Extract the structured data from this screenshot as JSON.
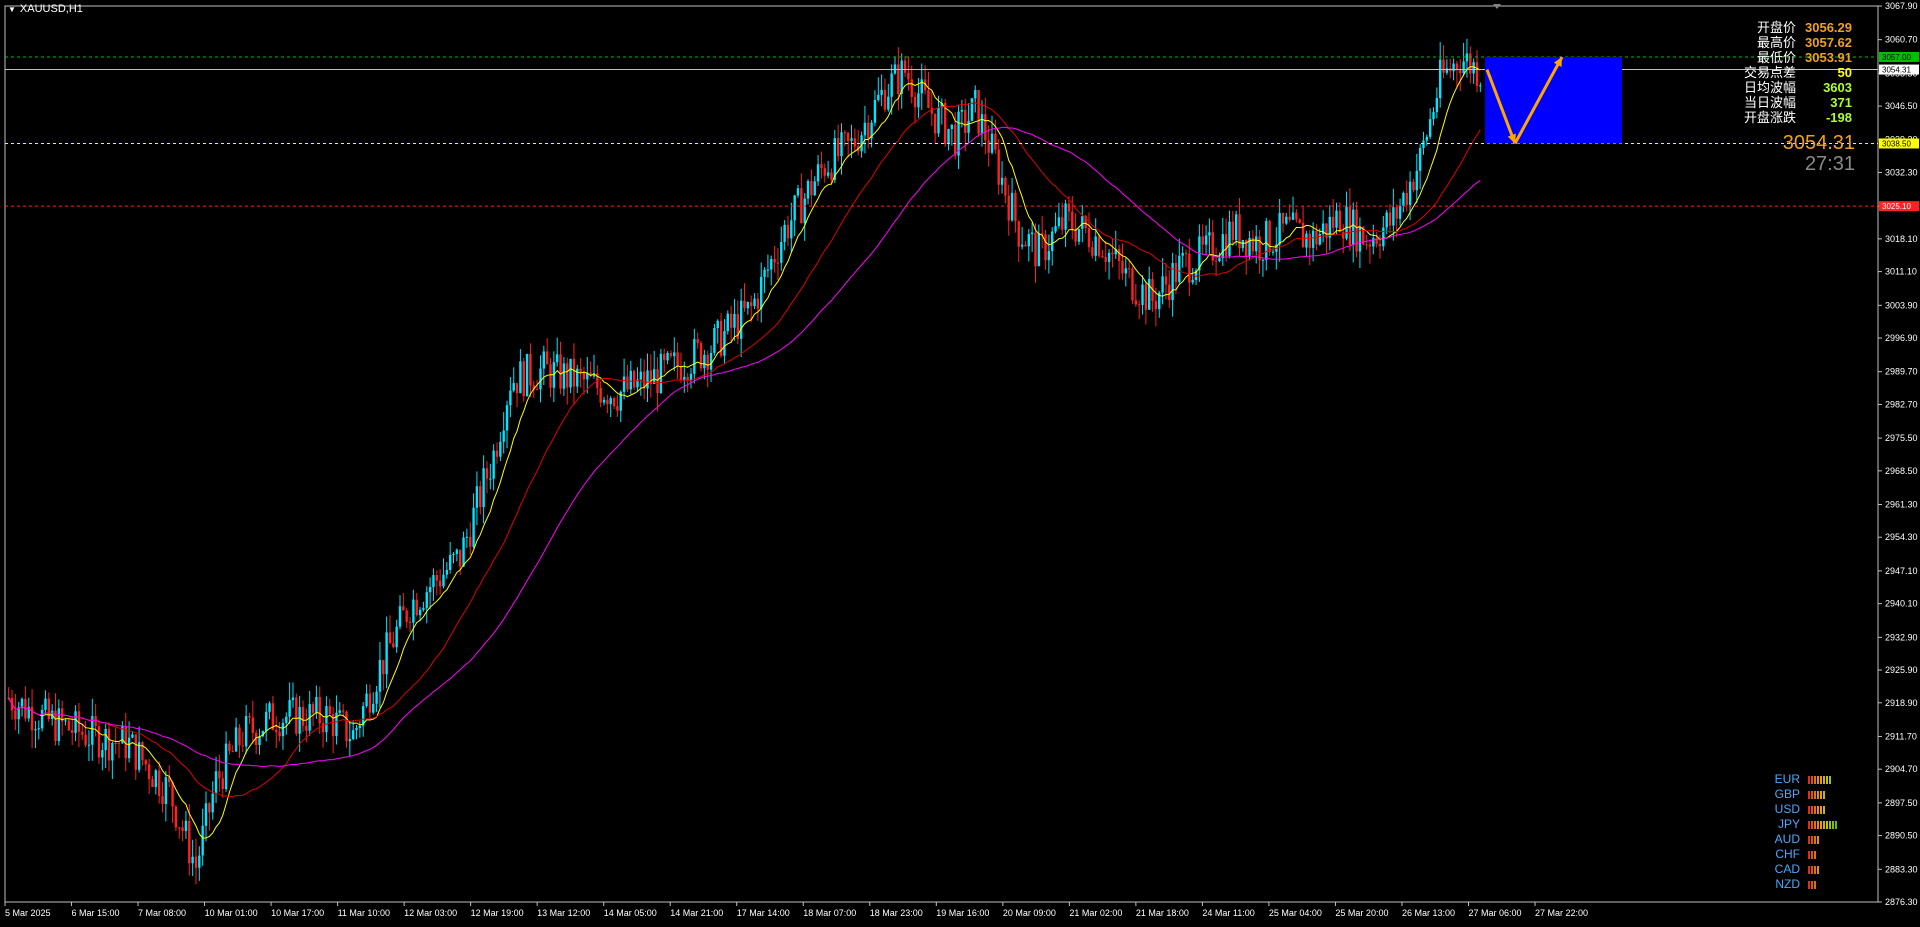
{
  "symbol": "XAUUSD,H1",
  "stats": [
    {
      "label": "开盘价",
      "value": "3056.29",
      "color": "#f0a020"
    },
    {
      "label": "最高价",
      "value": "3057.62",
      "color": "#f0a020"
    },
    {
      "label": "最低价",
      "value": "3053.91",
      "color": "#f0a020"
    },
    {
      "label": "交易点差",
      "value": "50",
      "color": "#ffff00"
    },
    {
      "label": "日均波幅",
      "value": "3603",
      "color": "#adff2f"
    },
    {
      "label": "当日波幅",
      "value": "371",
      "color": "#adff2f"
    },
    {
      "label": "开盘涨跌",
      "value": "-198",
      "color": "#adff2f"
    }
  ],
  "current_price": "3054.31",
  "countdown": "27:31",
  "currency_strength": [
    {
      "name": "EUR",
      "level": 8
    },
    {
      "name": "GBP",
      "level": 6
    },
    {
      "name": "USD",
      "level": 6
    },
    {
      "name": "JPY",
      "level": 10
    },
    {
      "name": "AUD",
      "level": 4
    },
    {
      "name": "CHF",
      "level": 3
    },
    {
      "name": "CAD",
      "level": 4
    },
    {
      "name": "NZD",
      "level": 3
    }
  ],
  "chart_data": {
    "type": "candlestick",
    "y_ticks": [
      "3067.90",
      "3060.70",
      "3053.50",
      "3046.50",
      "3039.30",
      "3032.30",
      "3025.10",
      "3018.10",
      "3011.10",
      "3003.90",
      "2996.90",
      "2989.70",
      "2982.70",
      "2975.50",
      "2968.50",
      "2961.30",
      "2954.30",
      "2947.10",
      "2940.10",
      "2932.90",
      "2925.90",
      "2918.90",
      "2911.70",
      "2904.70",
      "2897.50",
      "2890.50",
      "2883.30",
      "2876.30"
    ],
    "y_range": [
      2876.3,
      3067.9
    ],
    "x_ticks": [
      "5 Mar 2025",
      "6 Mar 15:00",
      "7 Mar 08:00",
      "10 Mar 01:00",
      "10 Mar 17:00",
      "11 Mar 10:00",
      "12 Mar 03:00",
      "12 Mar 19:00",
      "13 Mar 12:00",
      "14 Mar 05:00",
      "14 Mar 21:00",
      "17 Mar 14:00",
      "18 Mar 07:00",
      "18 Mar 23:00",
      "19 Mar 16:00",
      "20 Mar 09:00",
      "21 Mar 02:00",
      "21 Mar 18:00",
      "24 Mar 11:00",
      "25 Mar 04:00",
      "25 Mar 20:00",
      "26 Mar 13:00",
      "27 Mar 06:00",
      "27 Mar 22:00"
    ],
    "horizontal_lines": [
      {
        "price": 3057.0,
        "label": "3057.00",
        "color": "#00c000",
        "style": "dashed"
      },
      {
        "price": 3054.31,
        "label": "3054.31",
        "color": "#c0c0c0",
        "style": "solid"
      },
      {
        "price": 3038.5,
        "label": "3038.50",
        "color": "#ffff00",
        "style": "dashed"
      },
      {
        "price": 3025.1,
        "label": "3025.10",
        "color": "#ff2020",
        "style": "dashed"
      }
    ],
    "close_path": [
      {
        "x": 0,
        "c": 2920
      },
      {
        "x": 12,
        "c": 2915
      },
      {
        "x": 24,
        "c": 2912
      },
      {
        "x": 36,
        "c": 2910
      },
      {
        "x": 48,
        "c": 2900
      },
      {
        "x": 56,
        "c": 2884
      },
      {
        "x": 62,
        "c": 2902
      },
      {
        "x": 70,
        "c": 2912
      },
      {
        "x": 80,
        "c": 2916
      },
      {
        "x": 95,
        "c": 2916
      },
      {
        "x": 103,
        "c": 2912
      },
      {
        "x": 110,
        "c": 2925
      },
      {
        "x": 120,
        "c": 2940
      },
      {
        "x": 135,
        "c": 2950
      },
      {
        "x": 145,
        "c": 2972
      },
      {
        "x": 150,
        "c": 2988
      },
      {
        "x": 160,
        "c": 2990
      },
      {
        "x": 170,
        "c": 2988
      },
      {
        "x": 182,
        "c": 2985
      },
      {
        "x": 192,
        "c": 2988
      },
      {
        "x": 210,
        "c": 2995
      },
      {
        "x": 222,
        "c": 3003
      },
      {
        "x": 232,
        "c": 3020
      },
      {
        "x": 244,
        "c": 3034
      },
      {
        "x": 252,
        "c": 3038
      },
      {
        "x": 262,
        "c": 3050
      },
      {
        "x": 268,
        "c": 3054
      },
      {
        "x": 275,
        "c": 3046
      },
      {
        "x": 283,
        "c": 3040
      },
      {
        "x": 289,
        "c": 3046
      },
      {
        "x": 295,
        "c": 3035
      },
      {
        "x": 302,
        "c": 3020
      },
      {
        "x": 308,
        "c": 3015
      },
      {
        "x": 316,
        "c": 3022
      },
      {
        "x": 326,
        "c": 3018
      },
      {
        "x": 334,
        "c": 3010
      },
      {
        "x": 342,
        "c": 3005
      },
      {
        "x": 350,
        "c": 3012
      },
      {
        "x": 358,
        "c": 3015
      },
      {
        "x": 366,
        "c": 3020
      },
      {
        "x": 374,
        "c": 3017
      },
      {
        "x": 382,
        "c": 3020
      },
      {
        "x": 390,
        "c": 3018
      },
      {
        "x": 398,
        "c": 3023
      },
      {
        "x": 406,
        "c": 3018
      },
      {
        "x": 414,
        "c": 3022
      },
      {
        "x": 422,
        "c": 3035
      },
      {
        "x": 428,
        "c": 3052
      },
      {
        "x": 434,
        "c": 3057
      },
      {
        "x": 440,
        "c": 3054
      }
    ],
    "moving_averages": [
      {
        "color": "#ffff00"
      },
      {
        "color": "#e00000"
      },
      {
        "color": "#ff00ff"
      }
    ],
    "projection": {
      "box": {
        "price_top": 3057.0,
        "price_bottom": 3038.5,
        "color": "#0000ff"
      },
      "arrows": [
        {
          "from": 3054.31,
          "to": 3038.5,
          "color": "#ffa500"
        },
        {
          "from": 3038.5,
          "to": 3057.0,
          "color": "#ffa500"
        }
      ]
    }
  }
}
